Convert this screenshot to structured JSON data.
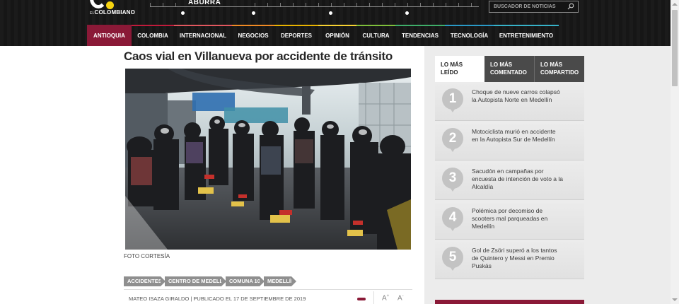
{
  "header": {
    "logo_text_small": "EL",
    "logo_text": "COLOMBIANO",
    "timeline_label": "ABURRA",
    "search_placeholder": "BUSCADOR DE NOTICIAS"
  },
  "nav": {
    "items": [
      {
        "label": "ANTIOQUIA",
        "color": "#8a1937"
      },
      {
        "label": "COLOMBIA",
        "color": "#c11b3b"
      },
      {
        "label": "INTERNACIONAL",
        "color": "#e2585f"
      },
      {
        "label": "NEGOCIOS",
        "color": "#f08a24"
      },
      {
        "label": "DEPORTES",
        "color": "#e8b300"
      },
      {
        "label": "OPINIÓN",
        "color": "#f7d232"
      },
      {
        "label": "CULTURA",
        "color": "#7fbf3b"
      },
      {
        "label": "TENDENCIAS",
        "color": "#3fae6a"
      },
      {
        "label": "TECNOLOGÍA",
        "color": "#2a9ac7"
      },
      {
        "label": "ENTRETENIMIENTO",
        "color": "#37b3c9"
      }
    ]
  },
  "article": {
    "headline": "Caos vial en Villanueva por accidente de tránsito",
    "photo_caption": "FOTO CORTESÍA",
    "tags": [
      "ACCIDENTES",
      "CENTRO DE MEDELLÍN",
      "COMUNA 10",
      "MEDELLÍN"
    ],
    "byline": "MATEO ISAZA GIRALDO | PUBLICADO EL 17 DE SEPTIEMBRE DE 2019",
    "font_increase": "A",
    "font_increase_sign": "+",
    "font_decrease": "A",
    "font_decrease_sign": "-"
  },
  "sidebar": {
    "tabs": [
      "LO MÁS\nLEÍDO",
      "LO MÁS\nCOMENTADO",
      "LO MÁS\nCOMPARTIDO"
    ],
    "ranked": [
      {
        "rank": "1",
        "title": "Choque de nueve carros colapsó la Autopista Norte en Medellín"
      },
      {
        "rank": "2",
        "title": "Motociclista murió en accidente en la Autopista Sur de Medellín"
      },
      {
        "rank": "3",
        "title": "Sacudón en campañas por encuesta de intención de voto a la Alcaldía"
      },
      {
        "rank": "4",
        "title": "Polémica por decomiso de scooters mal parqueadas en Medellín"
      },
      {
        "rank": "5",
        "title": "Gol de Zsöri superó a los tantos de Quintero y Messi en Premio Puskás"
      }
    ]
  },
  "colors": {
    "brand": "#8a1937",
    "header_bg": "#1b1b1b",
    "logo_dot": "#f6d30f"
  }
}
